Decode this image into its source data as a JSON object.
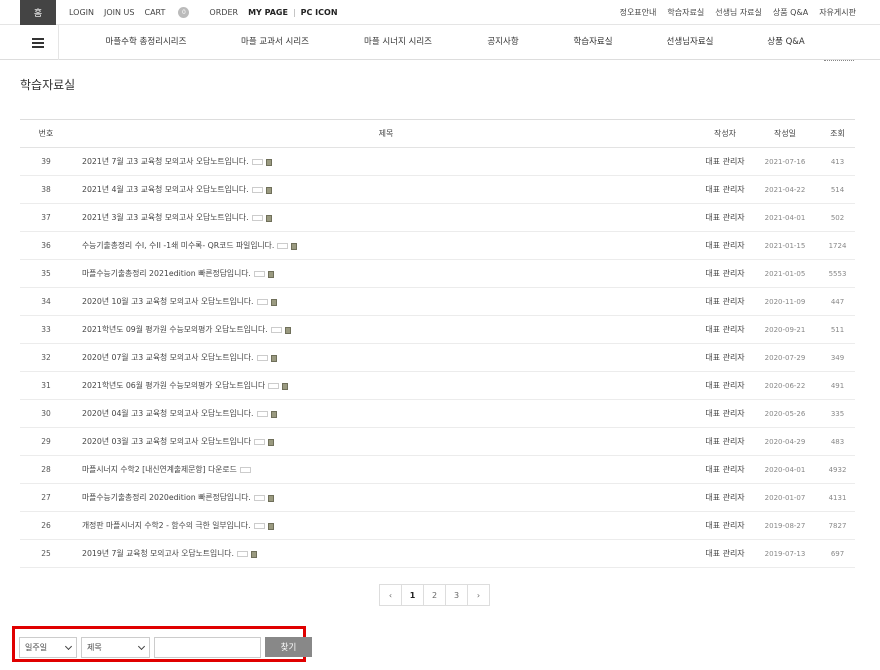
{
  "topbar": {
    "home_label": "홈",
    "left_links": [
      "LOGIN",
      "JOIN US",
      "CART",
      "ORDER",
      "MY PAGE",
      "PC ICON"
    ],
    "cart_count": "0",
    "right_links": [
      "정오표안내",
      "학습자료실",
      "선생님 자료실",
      "상품 Q&A",
      "자유게시판"
    ]
  },
  "nav": {
    "items": [
      "마플수학 총정리시리즈",
      "마플 교과서 시리즈",
      "마플 시너지 시리즈",
      "공지사항",
      "학습자료실",
      "선생님자료실",
      "상품 Q&A"
    ]
  },
  "page": {
    "title": "학습자료실"
  },
  "board": {
    "columns": [
      "번호",
      "제목",
      "작성자",
      "작성일",
      "조회"
    ],
    "rows": [
      {
        "no": "39",
        "subject": "2021년 7월 고3 교육청 모의고사 오답노트입니다.",
        "writer": "대표 관리자",
        "date": "2021-07-16",
        "hits": "413",
        "file": true
      },
      {
        "no": "38",
        "subject": "2021년 4월 고3 교육청 모의고사 오답노트입니다.",
        "writer": "대표 관리자",
        "date": "2021-04-22",
        "hits": "514",
        "file": true
      },
      {
        "no": "37",
        "subject": "2021년 3월 고3 교육청 모의고사 오답노트입니다.",
        "writer": "대표 관리자",
        "date": "2021-04-01",
        "hits": "502",
        "file": true
      },
      {
        "no": "36",
        "subject": "수능기출총정리 수I, 수II -1쇄 미수록- QR코드 파일입니다.",
        "writer": "대표 관리자",
        "date": "2021-01-15",
        "hits": "1724",
        "file": true
      },
      {
        "no": "35",
        "subject": "마플수능기출총정리 2021edition 빠른정답입니다.",
        "writer": "대표 관리자",
        "date": "2021-01-05",
        "hits": "5553",
        "file": true
      },
      {
        "no": "34",
        "subject": "2020년 10월 고3 교육청 모의고사 오답노트입니다.",
        "writer": "대표 관리자",
        "date": "2020-11-09",
        "hits": "447",
        "file": true
      },
      {
        "no": "33",
        "subject": "2021학년도 09월 평가원 수능모의평가 오답노트입니다.",
        "writer": "대표 관리자",
        "date": "2020-09-21",
        "hits": "511",
        "file": true
      },
      {
        "no": "32",
        "subject": "2020년 07월 고3 교육청 모의고사 오답노트입니다.",
        "writer": "대표 관리자",
        "date": "2020-07-29",
        "hits": "349",
        "file": true
      },
      {
        "no": "31",
        "subject": "2021학년도 06월 평가원 수능모의평가 오답노트입니다",
        "writer": "대표 관리자",
        "date": "2020-06-22",
        "hits": "491",
        "file": true
      },
      {
        "no": "30",
        "subject": "2020년 04월 고3 교육청 모의고사 오답노트입니다.",
        "writer": "대표 관리자",
        "date": "2020-05-26",
        "hits": "335",
        "file": true
      },
      {
        "no": "29",
        "subject": "2020년 03월 고3 교육청 모의고사 오답노트입니다",
        "writer": "대표 관리자",
        "date": "2020-04-29",
        "hits": "483",
        "file": true
      },
      {
        "no": "28",
        "subject": "마플시너지 수학2 [내신연계출제문항] 다운로드",
        "writer": "대표 관리자",
        "date": "2020-04-01",
        "hits": "4932",
        "file": false
      },
      {
        "no": "27",
        "subject": "마플수능기출총정리 2020edition 빠른정답입니다.",
        "writer": "대표 관리자",
        "date": "2020-01-07",
        "hits": "4131",
        "file": true
      },
      {
        "no": "26",
        "subject": "개정판 마플시너지 수학2 - 함수의 극한 일부입니다.",
        "writer": "대표 관리자",
        "date": "2019-08-27",
        "hits": "7827",
        "file": true
      },
      {
        "no": "25",
        "subject": "2019년 7월 교육청 모의고사 오답노트입니다.",
        "writer": "대표 관리자",
        "date": "2019-07-13",
        "hits": "697",
        "file": true
      }
    ]
  },
  "pagination": {
    "prev": "‹",
    "pages": [
      "1",
      "2",
      "3"
    ],
    "current": "1",
    "next": "›"
  },
  "search": {
    "period_value": "일주일",
    "field_value": "제목",
    "keyword_value": "",
    "button_label": "찾기"
  },
  "colors": {
    "highlight_border": "#e00000",
    "find_button": "#888888",
    "home_button": "#444444"
  }
}
